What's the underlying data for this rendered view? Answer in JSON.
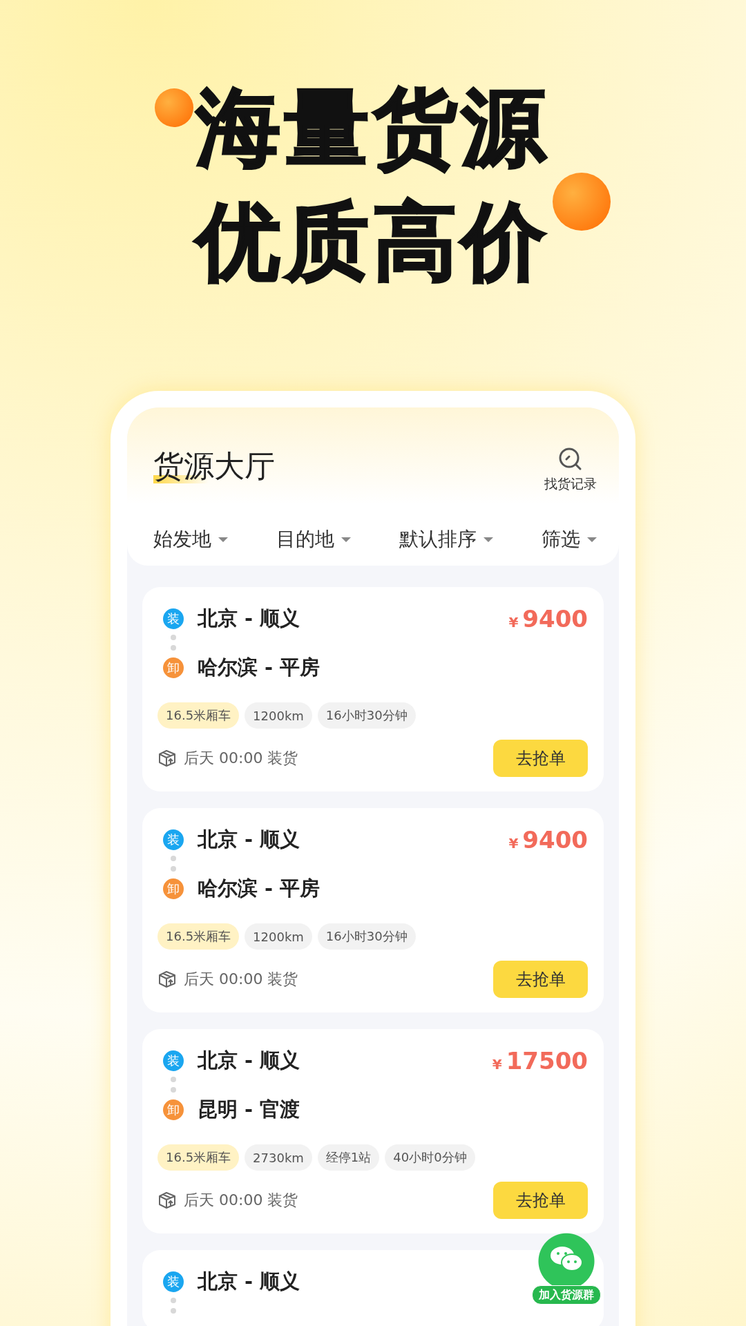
{
  "headline": [
    "海量货源",
    "优质高价"
  ],
  "header": {
    "title": "货源大厅",
    "history_label": "找货记录"
  },
  "filters": [
    {
      "label": "始发地"
    },
    {
      "label": "目的地"
    },
    {
      "label": "默认排序"
    },
    {
      "label": "筛选"
    }
  ],
  "cards": [
    {
      "load_badge": "装",
      "origin": "北京 - 顺义",
      "unload_badge": "卸",
      "destination": "哈尔滨 - 平房",
      "currency": "¥",
      "price": "9400",
      "tags": [
        {
          "text": "16.5米厢车",
          "kind": "vehicle"
        },
        {
          "text": "1200km",
          "kind": "info"
        },
        {
          "text": "16小时30分钟",
          "kind": "info"
        }
      ],
      "load_time": "后天 00:00 装货",
      "action": "去抢单"
    },
    {
      "load_badge": "装",
      "origin": "北京 - 顺义",
      "unload_badge": "卸",
      "destination": "哈尔滨 - 平房",
      "currency": "¥",
      "price": "9400",
      "tags": [
        {
          "text": "16.5米厢车",
          "kind": "vehicle"
        },
        {
          "text": "1200km",
          "kind": "info"
        },
        {
          "text": "16小时30分钟",
          "kind": "info"
        }
      ],
      "load_time": "后天 00:00 装货",
      "action": "去抢单"
    },
    {
      "load_badge": "装",
      "origin": "北京 - 顺义",
      "unload_badge": "卸",
      "destination": "昆明 - 官渡",
      "currency": "¥",
      "price": "17500",
      "tags": [
        {
          "text": "16.5米厢车",
          "kind": "vehicle"
        },
        {
          "text": "2730km",
          "kind": "info"
        },
        {
          "text": "经停1站",
          "kind": "info"
        },
        {
          "text": "40小时0分钟",
          "kind": "info"
        }
      ],
      "load_time": "后天 00:00 装货",
      "action": "去抢单"
    },
    {
      "load_badge": "装",
      "origin": "北京 - 顺义"
    }
  ],
  "float_button": {
    "label": "加入货源群"
  }
}
